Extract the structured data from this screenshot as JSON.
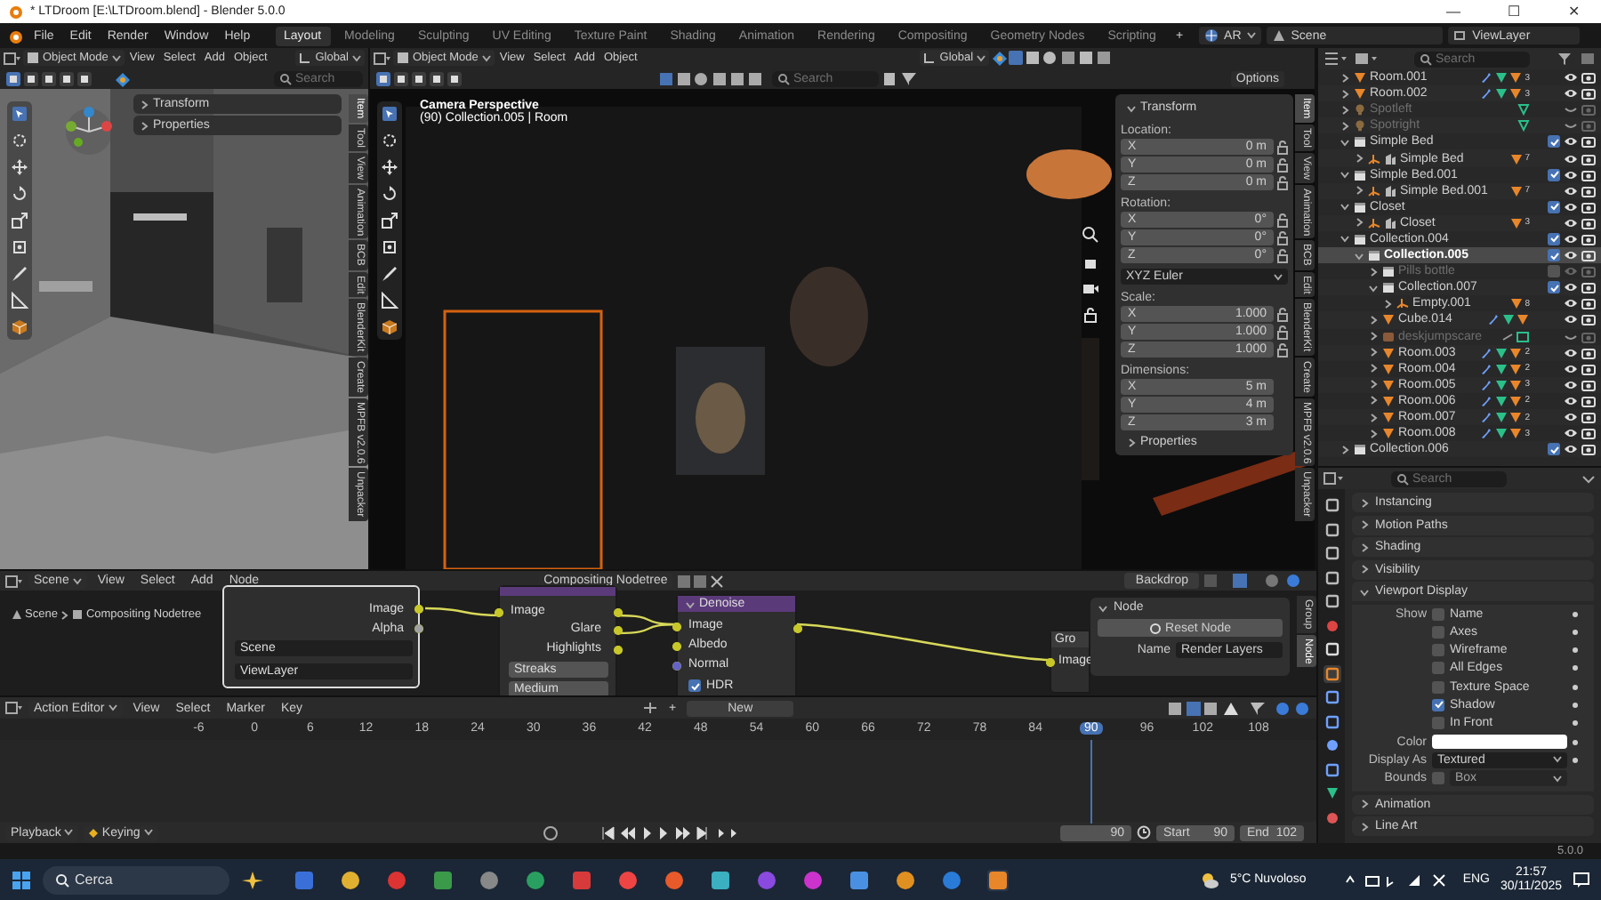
{
  "window": {
    "title": "* LTDroom [E:\\LTDroom.blend] - Blender 5.0.0",
    "controls": [
      "—",
      "☐",
      "✕"
    ]
  },
  "menu": [
    "File",
    "Edit",
    "Render",
    "Window",
    "Help"
  ],
  "workspaces": [
    {
      "label": "Layout",
      "selected": true
    },
    {
      "label": "Modeling",
      "selected": false
    },
    {
      "label": "Sculpting",
      "selected": false
    },
    {
      "label": "UV Editing",
      "selected": false
    },
    {
      "label": "Texture Paint",
      "selected": false
    },
    {
      "label": "Shading",
      "selected": false
    },
    {
      "label": "Animation",
      "selected": false
    },
    {
      "label": "Rendering",
      "selected": false
    },
    {
      "label": "Compositing",
      "selected": false
    },
    {
      "label": "Geometry Nodes",
      "selected": false
    },
    {
      "label": "Scripting",
      "selected": false
    }
  ],
  "add_workspace": "+",
  "scene_bar": {
    "engine": "AR",
    "scene": "Scene",
    "view_layer": "ViewLayer"
  },
  "viewports": [
    {
      "kind": "side",
      "mode": "Object Mode",
      "menus": [
        "View",
        "Select",
        "Add",
        "Object"
      ],
      "orientation": "Global",
      "search": {
        "placeholder": "Search"
      },
      "sidebar": {
        "panels": [
          {
            "title": "Transform",
            "expanded": false
          },
          {
            "title": "Properties",
            "expanded": false
          }
        ]
      },
      "tabs": [
        {
          "label": "Item",
          "selected": true
        },
        {
          "label": "Tool",
          "selected": false
        },
        {
          "label": "View",
          "selected": false
        },
        {
          "label": "Animation",
          "selected": false
        },
        {
          "label": "BCB",
          "selected": false
        },
        {
          "label": "Edit",
          "selected": false
        },
        {
          "label": "BlenderKit",
          "selected": false
        },
        {
          "label": "Create",
          "selected": false
        },
        {
          "label": "MPFB v2.0.6",
          "selected": false
        },
        {
          "label": "Unpacker",
          "selected": false
        }
      ]
    },
    {
      "kind": "camera",
      "mode": "Object Mode",
      "menus": [
        "View",
        "Select",
        "Add",
        "Object"
      ],
      "orientation": "Global",
      "search": {
        "placeholder": "Search"
      },
      "options": "Options",
      "camera_label": "Camera Perspective",
      "context": "(90) Collection.005 | Room",
      "sidebar": {
        "panels": [
          {
            "title": "Transform",
            "expanded": true,
            "groups": [
              {
                "label": "Location:",
                "lockable": true,
                "fields": [
                  {
                    "axis": "X",
                    "value": "0 m"
                  },
                  {
                    "axis": "Y",
                    "value": "0 m"
                  },
                  {
                    "axis": "Z",
                    "value": "0 m"
                  }
                ]
              },
              {
                "label": "Rotation:",
                "lockable": true,
                "fields": [
                  {
                    "axis": "X",
                    "value": "0°"
                  },
                  {
                    "axis": "Y",
                    "value": "0°"
                  },
                  {
                    "axis": "Z",
                    "value": "0°"
                  }
                ],
                "mode": "XYZ Euler"
              },
              {
                "label": "Scale:",
                "lockable": true,
                "fields": [
                  {
                    "axis": "X",
                    "value": "1.000"
                  },
                  {
                    "axis": "Y",
                    "value": "1.000"
                  },
                  {
                    "axis": "Z",
                    "value": "1.000"
                  }
                ]
              },
              {
                "label": "Dimensions:",
                "lockable": false,
                "fields": [
                  {
                    "axis": "X",
                    "value": "5 m"
                  },
                  {
                    "axis": "Y",
                    "value": "4 m"
                  },
                  {
                    "axis": "Z",
                    "value": "3 m"
                  }
                ]
              }
            ]
          },
          {
            "title": "Properties",
            "expanded": false
          }
        ]
      },
      "tabs": [
        {
          "label": "Item",
          "selected": true
        },
        {
          "label": "Tool",
          "selected": false
        },
        {
          "label": "View",
          "selected": false
        },
        {
          "label": "Animation",
          "selected": false
        },
        {
          "label": "BCB",
          "selected": false
        },
        {
          "label": "Edit",
          "selected": false
        },
        {
          "label": "BlenderKit",
          "selected": false
        },
        {
          "label": "Create",
          "selected": false
        },
        {
          "label": "MPFB v2.0.6",
          "selected": false
        },
        {
          "label": "Unpacker",
          "selected": false
        }
      ]
    }
  ],
  "node_editor": {
    "scene": "Scene",
    "menus": [
      "View",
      "Select",
      "Add",
      "Node"
    ],
    "tree": "Compositing Nodetree",
    "backdrop": "Backdrop",
    "breadcrumbs": [
      "Scene",
      "Compositing Nodetree"
    ],
    "nodes": [
      {
        "kind": "render_layers",
        "outputs": [
          "Image",
          "Alpha"
        ],
        "scene": "Scene",
        "view_layer": "ViewLayer"
      },
      {
        "kind": "glare",
        "inputs": [
          "Image"
        ],
        "outputs": [
          "Glare",
          "Highlights"
        ],
        "options": [
          "Streaks",
          "Medium"
        ]
      },
      {
        "kind": "denoise",
        "title": "Denoise",
        "inputs": [
          "Image",
          "Albedo",
          "Normal"
        ],
        "hdr": {
          "label": "HDR",
          "checked": true
        }
      },
      {
        "kind": "group_output",
        "title": "Gro",
        "inputs": [
          "Image"
        ]
      }
    ],
    "panel": {
      "title": "Node",
      "reset": "Reset Node",
      "name_label": "Name",
      "name": "Render Layers"
    },
    "tabs": [
      {
        "label": "Group",
        "selected": false
      },
      {
        "label": "Node",
        "selected": true
      }
    ]
  },
  "action_editor": {
    "mode": "Action Editor",
    "menus": [
      "View",
      "Select",
      "Marker",
      "Key"
    ],
    "add": "+",
    "new_action": "New",
    "ticks": [
      {
        "label": "-6",
        "selected": false
      },
      {
        "label": "0",
        "selected": false
      },
      {
        "label": "6",
        "selected": false
      },
      {
        "label": "12",
        "selected": false
      },
      {
        "label": "18",
        "selected": false
      },
      {
        "label": "24",
        "selected": false
      },
      {
        "label": "30",
        "selected": false
      },
      {
        "label": "36",
        "selected": false
      },
      {
        "label": "42",
        "selected": false
      },
      {
        "label": "48",
        "selected": false
      },
      {
        "label": "54",
        "selected": false
      },
      {
        "label": "60",
        "selected": false
      },
      {
        "label": "66",
        "selected": false
      },
      {
        "label": "72",
        "selected": false
      },
      {
        "label": "78",
        "selected": false
      },
      {
        "label": "84",
        "selected": false
      },
      {
        "label": "90",
        "selected": true
      },
      {
        "label": "96",
        "selected": false
      },
      {
        "label": "102",
        "selected": false
      },
      {
        "label": "108",
        "selected": false
      }
    ],
    "playback": "Playback",
    "keying": "Keying",
    "current_frame": "90",
    "start_label": "Start",
    "start": "90",
    "end_label": "End",
    "end": "102"
  },
  "outliner": {
    "search": {
      "placeholder": "Search"
    },
    "items": [
      {
        "name": "Room.001",
        "kind": "mesh",
        "count": "3",
        "expanded": false,
        "selected": false,
        "disabled": false,
        "hidden": false
      },
      {
        "name": "Room.002",
        "kind": "mesh",
        "count": "3",
        "expanded": false,
        "selected": false,
        "disabled": false,
        "hidden": false
      },
      {
        "name": "Spotleft",
        "kind": "light",
        "expanded": false,
        "selected": false,
        "disabled": true,
        "hidden": true
      },
      {
        "name": "Spotright",
        "kind": "light",
        "expanded": false,
        "selected": false,
        "disabled": true,
        "hidden": true
      },
      {
        "name": "Simple Bed",
        "kind": "collection",
        "checked": true,
        "expanded": true,
        "selected": false,
        "disabled": false,
        "hidden": false,
        "children": [
          {
            "name": "Simple Bed",
            "kind": "linked",
            "count": "7",
            "expanded": false,
            "selected": false,
            "disabled": false,
            "hidden": false
          }
        ]
      },
      {
        "name": "Simple Bed.001",
        "kind": "collection",
        "checked": true,
        "expanded": true,
        "selected": false,
        "disabled": false,
        "hidden": false,
        "children": [
          {
            "name": "Simple Bed.001",
            "kind": "linked",
            "count": "7",
            "expanded": false,
            "selected": false,
            "disabled": false,
            "hidden": false
          }
        ]
      },
      {
        "name": "Closet",
        "kind": "collection",
        "checked": true,
        "expanded": true,
        "selected": false,
        "disabled": false,
        "hidden": false,
        "children": [
          {
            "name": "Closet",
            "kind": "linked",
            "count": "3",
            "expanded": false,
            "selected": false,
            "disabled": false,
            "hidden": false
          }
        ]
      },
      {
        "name": "Collection.004",
        "kind": "collection",
        "checked": true,
        "expanded": true,
        "selected": false,
        "disabled": false,
        "hidden": false,
        "children": [
          {
            "name": "Collection.005",
            "kind": "collection",
            "checked": true,
            "expanded": true,
            "selected": true,
            "disabled": false,
            "hidden": false,
            "children": [
              {
                "name": "Pills bottle",
                "kind": "collection",
                "checked": false,
                "expanded": false,
                "selected": false,
                "disabled": true,
                "hidden": false
              },
              {
                "name": "Collection.007",
                "kind": "collection",
                "checked": true,
                "expanded": true,
                "selected": false,
                "disabled": false,
                "hidden": false,
                "children": [
                  {
                    "name": "Empty.001",
                    "kind": "empty",
                    "count": "8",
                    "expanded": false,
                    "selected": false,
                    "disabled": false,
                    "hidden": false
                  }
                ]
              },
              {
                "name": "Cube.014",
                "kind": "mesh",
                "expanded": false,
                "selected": false,
                "disabled": false,
                "hidden": false
              },
              {
                "name": "deskjumpscare",
                "kind": "other",
                "expanded": false,
                "selected": false,
                "disabled": true,
                "hidden": true
              },
              {
                "name": "Room.003",
                "kind": "mesh",
                "count": "2",
                "expanded": false,
                "selected": false,
                "disabled": false,
                "hidden": false
              },
              {
                "name": "Room.004",
                "kind": "mesh",
                "count": "2",
                "expanded": false,
                "selected": false,
                "disabled": false,
                "hidden": false
              },
              {
                "name": "Room.005",
                "kind": "mesh",
                "count": "3",
                "expanded": false,
                "selected": false,
                "disabled": false,
                "hidden": false
              },
              {
                "name": "Room.006",
                "kind": "mesh",
                "count": "2",
                "expanded": false,
                "selected": false,
                "disabled": false,
                "hidden": false
              },
              {
                "name": "Room.007",
                "kind": "mesh",
                "count": "2",
                "expanded": false,
                "selected": false,
                "disabled": false,
                "hidden": false
              },
              {
                "name": "Room.008",
                "kind": "mesh",
                "count": "3",
                "expanded": false,
                "selected": false,
                "disabled": false,
                "hidden": false
              }
            ]
          }
        ]
      },
      {
        "name": "Collection.006",
        "kind": "collection",
        "checked": true,
        "expanded": false,
        "selected": false,
        "disabled": false,
        "hidden": false
      }
    ]
  },
  "properties": {
    "search": {
      "placeholder": "Search"
    },
    "tabs": [
      {
        "kind": "tool",
        "selected": false
      },
      {
        "kind": "render",
        "selected": false
      },
      {
        "kind": "output",
        "selected": false
      },
      {
        "kind": "view_layer",
        "selected": false
      },
      {
        "kind": "scene",
        "selected": false
      },
      {
        "kind": "world",
        "selected": false
      },
      {
        "kind": "collection",
        "selected": false
      },
      {
        "kind": "object",
        "selected": true
      },
      {
        "kind": "modifiers",
        "selected": false
      },
      {
        "kind": "particles",
        "selected": false
      },
      {
        "kind": "physics",
        "selected": false
      },
      {
        "kind": "constraints",
        "selected": false
      },
      {
        "kind": "data",
        "selected": false
      },
      {
        "kind": "material",
        "selected": false
      }
    ],
    "panels": [
      {
        "title": "Instancing",
        "expanded": false
      },
      {
        "title": "Motion Paths",
        "expanded": false
      },
      {
        "title": "Shading",
        "expanded": false
      },
      {
        "title": "Visibility",
        "expanded": false
      },
      {
        "title": "Viewport Display",
        "expanded": true,
        "rows": [
          {
            "kind": "check",
            "label": "Show",
            "option": "Name",
            "checked": false
          },
          {
            "kind": "check",
            "option": "Axes",
            "checked": false
          },
          {
            "kind": "check",
            "option": "Wireframe",
            "checked": false
          },
          {
            "kind": "check",
            "option": "All Edges",
            "checked": false
          },
          {
            "kind": "check",
            "option": "Texture Space",
            "checked": false
          },
          {
            "kind": "check",
            "option": "Shadow",
            "checked": true
          },
          {
            "kind": "check",
            "option": "In Front",
            "checked": false
          },
          {
            "kind": "color",
            "label": "Color",
            "color": "#ffffff"
          },
          {
            "kind": "select",
            "label": "Display As",
            "value": "Textured",
            "disabled": false
          },
          {
            "kind": "checkselect",
            "label": "Bounds",
            "checked": false,
            "value": "Box",
            "disabled": true
          }
        ]
      },
      {
        "title": "Animation",
        "expanded": false
      },
      {
        "title": "Line Art",
        "expanded": false
      }
    ]
  },
  "status_bar": {
    "version": "5.0.0"
  },
  "taskbar": {
    "search": {
      "placeholder": "Cerca"
    },
    "weather": "5°C Nuvoloso",
    "language": "ENG",
    "time": "21:57",
    "date": "30/11/2025"
  }
}
